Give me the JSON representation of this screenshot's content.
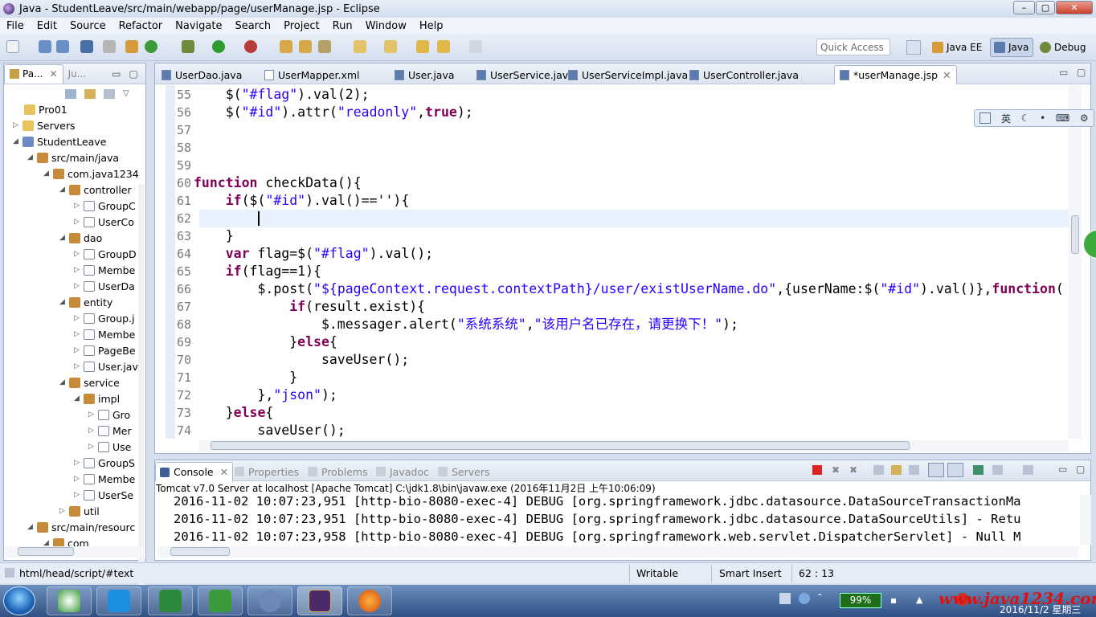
{
  "window": {
    "title": "Java - StudentLeave/src/main/webapp/page/userManage.jsp - Eclipse"
  },
  "menu": [
    "File",
    "Edit",
    "Source",
    "Refactor",
    "Navigate",
    "Search",
    "Project",
    "Run",
    "Window",
    "Help"
  ],
  "quick_access": {
    "placeholder": "Quick Access"
  },
  "perspectives": [
    {
      "label": "Java EE"
    },
    {
      "label": "Java"
    },
    {
      "label": "Debug"
    }
  ],
  "package_explorer": {
    "tabs": [
      "Pa...",
      "Ju..."
    ],
    "items": [
      {
        "label": "Pro01",
        "icon": "folder-icon"
      },
      {
        "label": "Servers",
        "icon": "folder-icon"
      },
      {
        "label": "StudentLeave",
        "icon": "project-icon"
      },
      {
        "label": "src/main/java",
        "icon": "source-folder-icon"
      },
      {
        "label": "com.java1234",
        "icon": "package-icon"
      },
      {
        "label": "controller",
        "icon": "package-icon"
      },
      {
        "label": "GroupC",
        "icon": "java-file-icon"
      },
      {
        "label": "UserCo",
        "icon": "java-file-icon"
      },
      {
        "label": "dao",
        "icon": "package-icon"
      },
      {
        "label": "GroupD",
        "icon": "java-file-icon"
      },
      {
        "label": "Membe",
        "icon": "java-file-icon"
      },
      {
        "label": "UserDa",
        "icon": "java-file-icon"
      },
      {
        "label": "entity",
        "icon": "package-icon"
      },
      {
        "label": "Group.j",
        "icon": "java-file-icon"
      },
      {
        "label": "Membe",
        "icon": "java-file-icon"
      },
      {
        "label": "PageBe",
        "icon": "java-file-icon"
      },
      {
        "label": "User.jav",
        "icon": "java-file-icon"
      },
      {
        "label": "service",
        "icon": "package-icon"
      },
      {
        "label": "impl",
        "icon": "package-icon"
      },
      {
        "label": "Gro",
        "icon": "java-file-icon"
      },
      {
        "label": "Mer",
        "icon": "java-file-icon"
      },
      {
        "label": "Use",
        "icon": "java-file-icon"
      },
      {
        "label": "GroupS",
        "icon": "java-file-icon"
      },
      {
        "label": "Membe",
        "icon": "java-file-icon"
      },
      {
        "label": "UserSe",
        "icon": "java-file-icon"
      },
      {
        "label": "util",
        "icon": "package-icon"
      },
      {
        "label": "src/main/resourc",
        "icon": "source-folder-icon"
      },
      {
        "label": "com",
        "icon": "package-icon"
      }
    ]
  },
  "editor_tabs": [
    {
      "label": "UserDao.java"
    },
    {
      "label": "UserMapper.xml"
    },
    {
      "label": "User.java"
    },
    {
      "label": "UserService.java"
    },
    {
      "label": "UserServiceImpl.java"
    },
    {
      "label": "UserController.java"
    },
    {
      "label": "*userManage.jsp"
    }
  ],
  "ime_bar": {
    "label": "英"
  },
  "code_lines": [
    {
      "num": "55",
      "text": "    $(\"#flag\").val(2);"
    },
    {
      "num": "56",
      "text": "    $(\"#id\").attr(\"readonly\",true);"
    },
    {
      "num": "57",
      "text": ""
    },
    {
      "num": "58",
      "text": ""
    },
    {
      "num": "59",
      "text": ""
    },
    {
      "num": "60",
      "text": "function checkData(){"
    },
    {
      "num": "61",
      "text": "    if($(\"#id\").val()==''){"
    },
    {
      "num": "62",
      "text": ""
    },
    {
      "num": "63",
      "text": "    }"
    },
    {
      "num": "64",
      "text": "    var flag=$(\"#flag\").val();"
    },
    {
      "num": "65",
      "text": "    if(flag==1){"
    },
    {
      "num": "66",
      "text": "        $.post(\"${pageContext.request.contextPath}/user/existUserName.do\",{userName:$(\"#id\").val()},function("
    },
    {
      "num": "67",
      "text": "            if(result.exist){"
    },
    {
      "num": "68",
      "text": "                $.messager.alert(\"系统系统\",\"该用户名已存在，请更换下！\");"
    },
    {
      "num": "69",
      "text": "            }else{"
    },
    {
      "num": "70",
      "text": "                saveUser();"
    },
    {
      "num": "71",
      "text": "            }"
    },
    {
      "num": "72",
      "text": "        },\"json\");"
    },
    {
      "num": "73",
      "text": "    }else{"
    },
    {
      "num": "74",
      "text": "        saveUser();"
    }
  ],
  "console": {
    "tabs": [
      "Console",
      "Properties",
      "Problems",
      "Javadoc",
      "Servers"
    ],
    "header": "Tomcat v7.0 Server at localhost [Apache Tomcat] C:\\jdk1.8\\bin\\javaw.exe (2016年11月2日 上午10:06:09)",
    "lines": [
      "2016-11-02 10:07:23,951 [http-bio-8080-exec-4] DEBUG [org.springframework.jdbc.datasource.DataSourceTransactionMa",
      "2016-11-02 10:07:23,951 [http-bio-8080-exec-4] DEBUG [org.springframework.jdbc.datasource.DataSourceUtils] - Retu",
      "2016-11-02 10:07:23,958 [http-bio-8080-exec-4] DEBUG [org.springframework.web.servlet.DispatcherServlet] - Null M"
    ]
  },
  "status": {
    "path": "html/head/script/#text",
    "mode": "Writable",
    "insert": "Smart Insert",
    "position": "62 : 13"
  },
  "taskbar": {
    "battery": "99%",
    "watermark": "www.java1234.com",
    "date": "2016/11/2 星期三"
  }
}
